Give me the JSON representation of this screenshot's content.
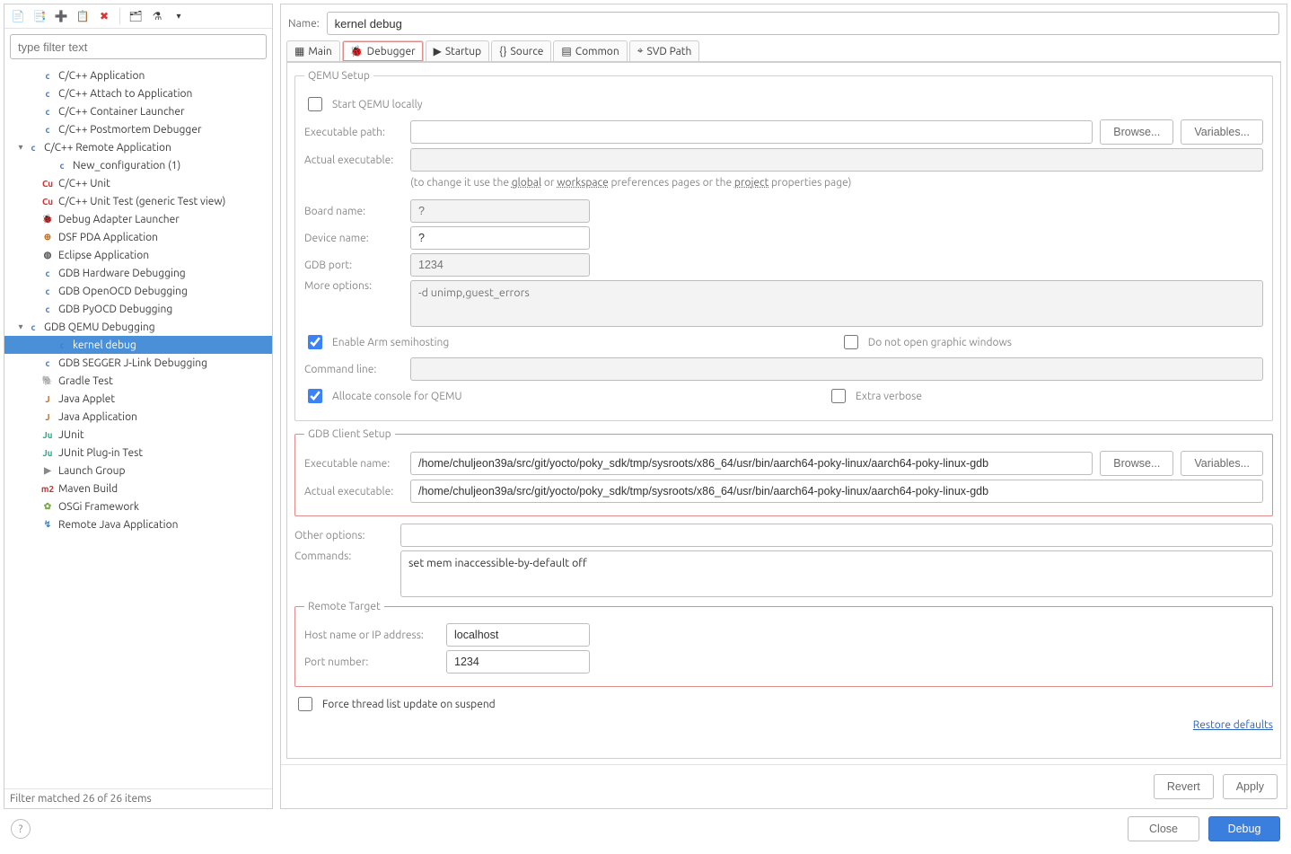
{
  "filter": {
    "placeholder": "type filter text"
  },
  "tree": {
    "items": [
      {
        "label": "C/C++ Application",
        "indent": 1,
        "twisty": ""
      },
      {
        "label": "C/C++ Attach to Application",
        "indent": 1,
        "twisty": ""
      },
      {
        "label": "C/C++ Container Launcher",
        "indent": 1,
        "twisty": ""
      },
      {
        "label": "C/C++ Postmortem Debugger",
        "indent": 1,
        "twisty": ""
      },
      {
        "label": "C/C++ Remote Application",
        "indent": 0,
        "twisty": "▾"
      },
      {
        "label": "New_configuration (1)",
        "indent": 2,
        "twisty": ""
      },
      {
        "label": "C/C++ Unit",
        "indent": 1,
        "twisty": ""
      },
      {
        "label": "C/C++ Unit Test (generic Test view)",
        "indent": 1,
        "twisty": ""
      },
      {
        "label": "Debug Adapter Launcher",
        "indent": 1,
        "twisty": ""
      },
      {
        "label": "DSF PDA Application",
        "indent": 1,
        "twisty": ""
      },
      {
        "label": "Eclipse Application",
        "indent": 1,
        "twisty": ""
      },
      {
        "label": "GDB Hardware Debugging",
        "indent": 1,
        "twisty": ""
      },
      {
        "label": "GDB OpenOCD Debugging",
        "indent": 1,
        "twisty": ""
      },
      {
        "label": "GDB PyOCD Debugging",
        "indent": 1,
        "twisty": ""
      },
      {
        "label": "GDB QEMU Debugging",
        "indent": 0,
        "twisty": "▾"
      },
      {
        "label": "kernel debug",
        "indent": 2,
        "twisty": "",
        "selected": true
      },
      {
        "label": "GDB SEGGER J-Link Debugging",
        "indent": 1,
        "twisty": ""
      },
      {
        "label": "Gradle Test",
        "indent": 1,
        "twisty": ""
      },
      {
        "label": "Java Applet",
        "indent": 1,
        "twisty": ""
      },
      {
        "label": "Java Application",
        "indent": 1,
        "twisty": ""
      },
      {
        "label": "JUnit",
        "indent": 1,
        "twisty": ""
      },
      {
        "label": "JUnit Plug-in Test",
        "indent": 1,
        "twisty": ""
      },
      {
        "label": "Launch Group",
        "indent": 1,
        "twisty": ""
      },
      {
        "label": "Maven Build",
        "indent": 1,
        "twisty": ""
      },
      {
        "label": "OSGi Framework",
        "indent": 1,
        "twisty": ""
      },
      {
        "label": "Remote Java Application",
        "indent": 1,
        "twisty": ""
      }
    ]
  },
  "tree_status": "Filter matched 26 of 26 items",
  "name": {
    "label": "Name:",
    "value": "kernel debug"
  },
  "tabs": [
    "Main",
    "Debugger",
    "Startup",
    "Source",
    "Common",
    "SVD Path"
  ],
  "active_tab": "Debugger",
  "qemu": {
    "legend": "QEMU Setup",
    "start_local_label": "Start QEMU locally",
    "exec_label": "Executable path:",
    "actual_label": "Actual executable:",
    "hint_pre": "(to change it use the ",
    "hint_global": "global",
    "hint_or": " or ",
    "hint_ws": "workspace",
    "hint_mid": " preferences pages or the ",
    "hint_proj": "project",
    "hint_post": " properties page)",
    "board_label": "Board name:",
    "board_ph": "?",
    "device_label": "Device name:",
    "device_val": "?",
    "gdbport_label": "GDB port:",
    "gdbport_ph": "1234",
    "more_label": "More options:",
    "more_ph": "-d unimp,guest_errors",
    "semi_label": "Enable Arm semihosting",
    "nographic_label": "Do not open graphic windows",
    "cmdline_label": "Command line:",
    "alloc_label": "Allocate console for QEMU",
    "verbose_label": "Extra verbose"
  },
  "gdb": {
    "legend": "GDB Client Setup",
    "exec_label": "Executable name:",
    "exec_val": "/home/chuljeon39a/src/git/yocto/poky_sdk/tmp/sysroots/x86_64/usr/bin/aarch64-poky-linux/aarch64-poky-linux-gdb",
    "actual_label": "Actual executable:",
    "actual_val": "/home/chuljeon39a/src/git/yocto/poky_sdk/tmp/sysroots/x86_64/usr/bin/aarch64-poky-linux/aarch64-poky-linux-gdb",
    "other_label": "Other options:",
    "cmds_label": "Commands:",
    "cmds_val": "set mem inaccessible-by-default off"
  },
  "remote": {
    "legend": "Remote Target",
    "host_label": "Host name or IP address:",
    "host_val": "localhost",
    "port_label": "Port number:",
    "port_val": "1234"
  },
  "force_label": "Force thread list update on suspend",
  "restore_label": "Restore defaults",
  "browse_label": "Browse...",
  "vars_label": "Variables...",
  "revert_label": "Revert",
  "apply_label": "Apply",
  "close_label": "Close",
  "debug_label": "Debug",
  "icons": {
    "c": "c",
    "cu": "Cu",
    "bug": "🐞",
    "plus": "⊕",
    "eclipse": "◍",
    "gradle": "🐘",
    "java": "J",
    "junit": "Ju",
    "launch": "▶",
    "m2": "m2",
    "osgi": "✿",
    "rj": "↯",
    "new": "📄",
    "dup": "📑",
    "export": "➕",
    "paste": "📋",
    "del": "✖",
    "col": "🗂",
    "flt": "⚗"
  }
}
